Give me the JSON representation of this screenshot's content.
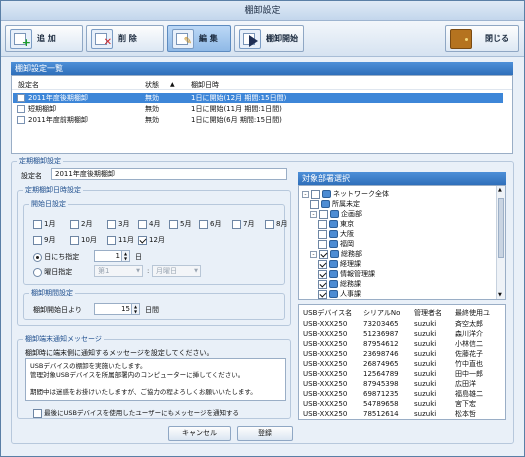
{
  "window": {
    "title": "棚卸設定"
  },
  "toolbar": {
    "add": "追 加",
    "delete": "削 除",
    "edit": "編 集",
    "start": "棚卸開始",
    "close": "閉じる"
  },
  "list_panel": {
    "title": "棚卸設定一覧",
    "columns": [
      "設定名",
      "状態",
      "棚卸日時"
    ],
    "rows": [
      {
        "name": "2011年度後期棚卸",
        "status": "無効",
        "schedule": "1日に開始(12月 期間:15日間)"
      },
      {
        "name": "短期棚卸",
        "status": "無効",
        "schedule": "1日に開始(11月 期間:1日間)"
      },
      {
        "name": "2011年度前期棚卸",
        "status": "無効",
        "schedule": "1日に開始(6月 期間:15日間)"
      }
    ]
  },
  "regular": {
    "group_title": "定期棚卸設定",
    "name_label": "設定名",
    "name_value": "2011年度後期棚卸",
    "datetime_group": "定期棚卸日時設定",
    "start_group": "開始日設定",
    "months": [
      "1月",
      "2月",
      "3月",
      "4月",
      "5月",
      "6月",
      "7月",
      "8月",
      "9月",
      "10月",
      "11月",
      "12月"
    ],
    "months_checked": [
      false,
      false,
      false,
      false,
      false,
      false,
      false,
      false,
      false,
      false,
      false,
      true
    ],
    "day_label": "日にち指定",
    "day_value": "1",
    "day_unit": "日",
    "weekday_label": "曜日指定",
    "week_value": "第1",
    "weekday_value": "月曜日",
    "period_group": "棚卸期間設定",
    "period_label": "棚卸開始日より",
    "period_value": "15",
    "period_unit": "日間"
  },
  "message": {
    "group_title": "棚卸端末通知メッセージ",
    "description": "棚卸時に端末側に通知するメッセージを設定してください。",
    "lines": [
      "USBデバイスの棚卸を実施いたします。",
      "管理対象USBデバイスを所属部署内のコンピューターに挿してください。",
      "",
      "期間中は迷惑をお掛けいたしますが、ご協力の程よろしくお願いいたします。"
    ],
    "notify_last_user": "最後にUSBデバイスを使用したユーザーにもメッセージを通知する"
  },
  "buttons": {
    "cancel": "キャンセル",
    "register": "登録"
  },
  "target": {
    "title": "対象部署選択",
    "tree": [
      {
        "label": "ネットワーク全体",
        "checked": false
      },
      {
        "label": "所属未定",
        "checked": false
      },
      {
        "label": "企画部",
        "checked": false
      },
      {
        "label": "東京",
        "checked": false
      },
      {
        "label": "大阪",
        "checked": false
      },
      {
        "label": "福岡",
        "checked": false
      },
      {
        "label": "総務部",
        "checked": true
      },
      {
        "label": "経理課",
        "checked": true
      },
      {
        "label": "情報管理課",
        "checked": true
      },
      {
        "label": "総務課",
        "checked": true
      },
      {
        "label": "人事課",
        "checked": true
      }
    ],
    "device_columns": [
      "USBデバイス名",
      "シリアルNo",
      "管理者名",
      "最終使用ユ"
    ],
    "devices": [
      [
        "USB-XXX250",
        "73203465",
        "suzuki",
        "斉空太郎"
      ],
      [
        "USB-XXX250",
        "51236987",
        "suzuki",
        "森川洋介"
      ],
      [
        "USB-XXX250",
        "87954612",
        "suzuki",
        "小林信二"
      ],
      [
        "USB-XXX250",
        "23698746",
        "suzuki",
        "佐藤花子"
      ],
      [
        "USB-XXX250",
        "26874965",
        "suzuki",
        "竹中直也"
      ],
      [
        "USB-XXX250",
        "12564789",
        "suzuki",
        "田中一郎"
      ],
      [
        "USB-XXX250",
        "87945398",
        "suzuki",
        "広田洋"
      ],
      [
        "USB-XXX250",
        "69871235",
        "suzuki",
        "福島雄二"
      ],
      [
        "USB-XXX250",
        "54789658",
        "suzuki",
        "宮下宏"
      ],
      [
        "USB-XXX250",
        "78512614",
        "suzuki",
        "松本哲"
      ]
    ]
  }
}
